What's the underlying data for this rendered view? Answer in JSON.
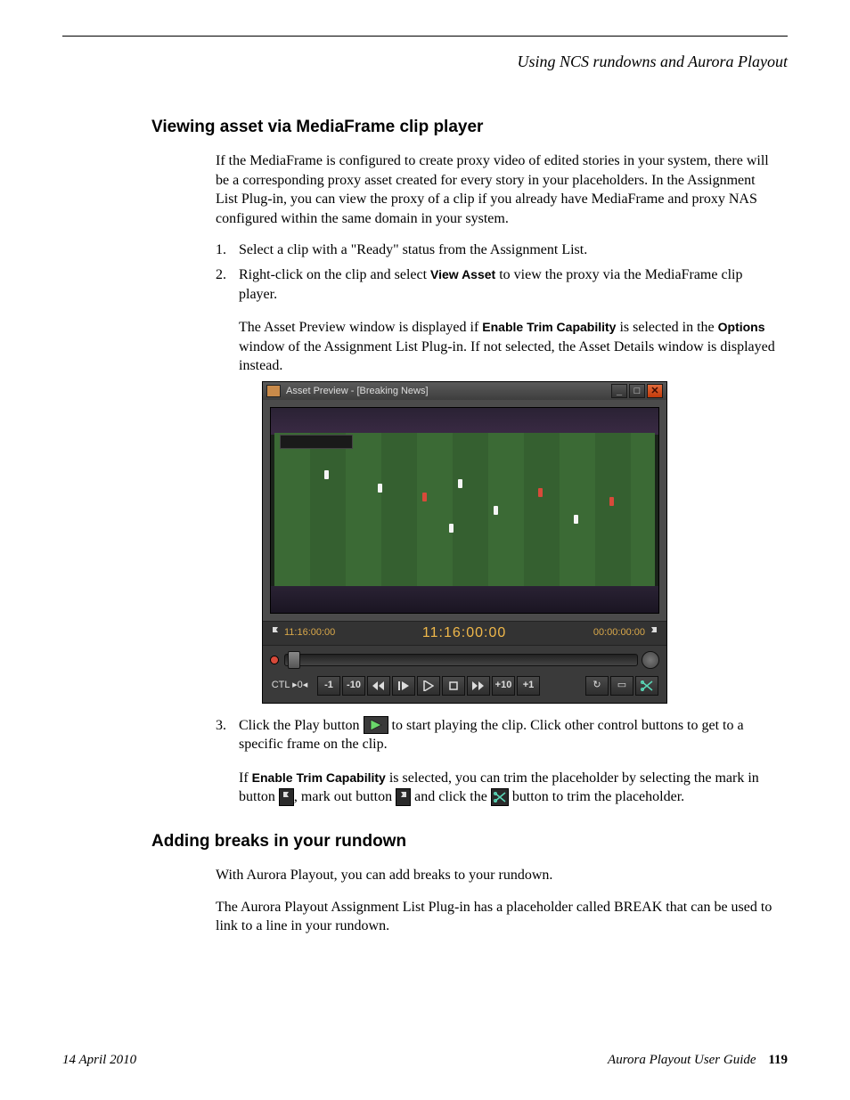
{
  "chapter_title": "Using NCS rundowns and Aurora Playout",
  "section1": {
    "heading": "Viewing asset via MediaFrame clip player",
    "intro": "If the MediaFrame is configured to create proxy video of edited stories in your system, there will be a corresponding proxy asset created for every story in your placeholders. In the Assignment List Plug-in, you can view the proxy of a clip if you already have MediaFrame and proxy NAS configured within the same domain in your system.",
    "step1": "Select a clip with a \"Ready\" status from the Assignment List.",
    "step2_pre": "Right-click on the clip and select ",
    "step2_bold": "View Asset",
    "step2_post": " to view the proxy via the MediaFrame clip player.",
    "step2_note_pre": "The Asset Preview window is displayed if ",
    "step2_note_b1": "Enable Trim Capability",
    "step2_note_mid": " is selected in the ",
    "step2_note_b2": "Options",
    "step2_note_post": " window of the Assignment List Plug-in. If not selected, the Asset Details window is displayed instead.",
    "step3_pre": "Click the Play button ",
    "step3_post": " to start playing the clip. Click other control buttons to get to a specific frame on the clip.",
    "step3_note_pre": "If ",
    "step3_note_b1": "Enable Trim Capability",
    "step3_note_mid": " is selected, you can trim the placeholder by selecting the mark in button ",
    "step3_note_mid2": ", mark out button ",
    "step3_note_mid3": " and click the ",
    "step3_note_post": " button to trim the placeholder."
  },
  "preview": {
    "title": "Asset Preview - [Breaking News]",
    "tc_in": "11:16:00:00",
    "tc_center": "11:16:00:00",
    "tc_out": "00:00:00:00",
    "ctl_label": "CTL  ▸0◂",
    "minus1": "-1",
    "minus10": "-10",
    "plus10": "+10",
    "plus1": "+1"
  },
  "section2": {
    "heading": "Adding breaks in your rundown",
    "p1": "With Aurora Playout, you can add breaks to your rundown.",
    "p2": "The Aurora Playout Assignment List Plug-in has a placeholder called BREAK that can be used to link to a line in your rundown."
  },
  "footer": {
    "left": "14  April  2010",
    "right": "Aurora Playout User Guide",
    "page": "119"
  }
}
